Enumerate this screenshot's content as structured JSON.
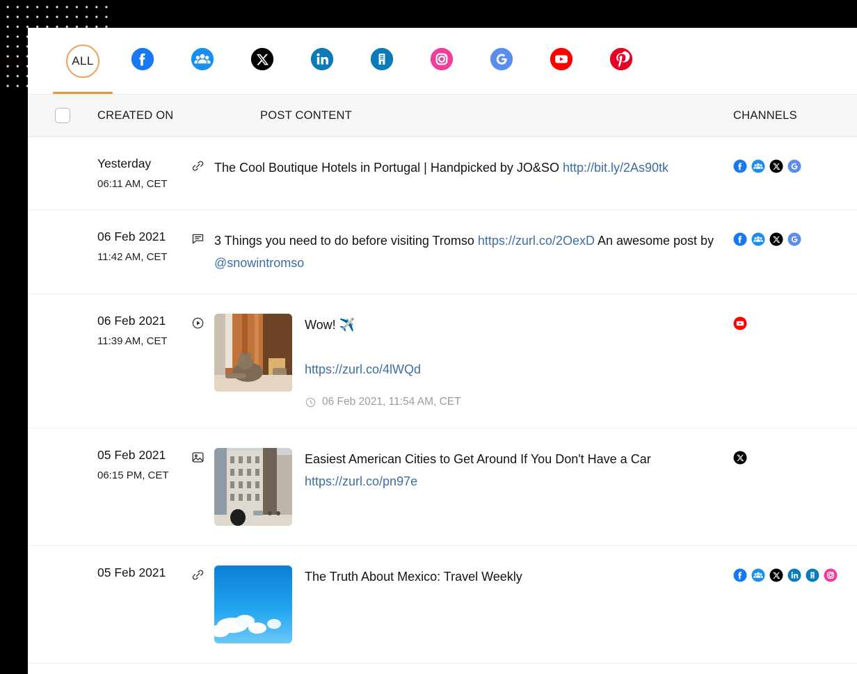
{
  "channel_tabs": [
    {
      "key": "all",
      "label": "ALL",
      "icon": "all-text",
      "active": true
    },
    {
      "key": "facebook",
      "label": "Facebook",
      "icon": "facebook-icon",
      "active": false
    },
    {
      "key": "fbgroup",
      "label": "Facebook Group",
      "icon": "facebook-group-icon",
      "active": false
    },
    {
      "key": "x",
      "label": "X",
      "icon": "x-twitter-icon",
      "active": false
    },
    {
      "key": "linkedin",
      "label": "LinkedIn",
      "icon": "linkedin-icon",
      "active": false
    },
    {
      "key": "lipage",
      "label": "LinkedIn Page",
      "icon": "linkedin-company-icon",
      "active": false
    },
    {
      "key": "instagram",
      "label": "Instagram",
      "icon": "instagram-icon",
      "active": false
    },
    {
      "key": "google",
      "label": "Google Business",
      "icon": "google-business-icon",
      "active": false
    },
    {
      "key": "youtube",
      "label": "YouTube",
      "icon": "youtube-icon",
      "active": false
    },
    {
      "key": "pinterest",
      "label": "Pinterest",
      "icon": "pinterest-icon",
      "active": false
    }
  ],
  "table": {
    "headers": {
      "select_all": "",
      "created_on": "CREATED ON",
      "post_content": "POST CONTENT",
      "channels": "CHANNELS"
    },
    "rows": [
      {
        "date": "Yesterday",
        "time": "06:11 AM, CET",
        "type_icon": "link-icon",
        "has_thumb": false,
        "segments": [
          {
            "text": "The Cool Boutique Hotels in Portugal | Handpicked by JO&SO ",
            "link": false
          },
          {
            "text": "http://bit.ly/2As90tk",
            "link": true
          }
        ],
        "scheduled": null,
        "channels": [
          "facebook-icon",
          "facebook-group-icon",
          "x-twitter-icon",
          "google-business-icon"
        ]
      },
      {
        "date": "06 Feb 2021",
        "time": "11:42 AM, CET",
        "type_icon": "text-post-icon",
        "has_thumb": false,
        "segments": [
          {
            "text": "3 Things you need to do before visiting Tromso ",
            "link": false
          },
          {
            "text": "https://zurl.co/2OexD",
            "link": true
          },
          {
            "text": " An awesome post by ",
            "link": false
          },
          {
            "text": "@snowintromso",
            "link": true
          }
        ],
        "scheduled": null,
        "channels": [
          "facebook-icon",
          "facebook-group-icon",
          "x-twitter-icon",
          "google-business-icon"
        ]
      },
      {
        "date": "06 Feb 2021",
        "time": "11:39 AM, CET",
        "type_icon": "video-icon",
        "has_thumb": true,
        "thumb_kind": "cat-photo",
        "segments": [
          {
            "text": "Wow! ✈️",
            "link": false
          },
          {
            "text": "\n",
            "link": false
          },
          {
            "text": "https://zurl.co/4lWQd",
            "link": true
          }
        ],
        "scheduled": "06 Feb 2021, 11:54 AM, CET",
        "channels": [
          "youtube-icon"
        ]
      },
      {
        "date": "05 Feb 2021",
        "time": "06:15 PM, CET",
        "type_icon": "image-icon",
        "has_thumb": true,
        "thumb_kind": "city-photo",
        "segments": [
          {
            "text": "Easiest American Cities to Get Around If You Don't Have a Car ",
            "link": false
          },
          {
            "text": "https://zurl.co/pn97e",
            "link": true
          }
        ],
        "scheduled": null,
        "channels": [
          "x-twitter-icon"
        ]
      },
      {
        "date": "05 Feb 2021",
        "time": "",
        "type_icon": "link-icon",
        "has_thumb": true,
        "thumb_kind": "sky-photo",
        "segments": [
          {
            "text": "The Truth About Mexico: Travel Weekly",
            "link": false
          }
        ],
        "scheduled": null,
        "channels": [
          "facebook-icon",
          "facebook-group-icon",
          "x-twitter-icon",
          "linkedin-icon",
          "linkedin-company-icon",
          "instagram-icon"
        ]
      }
    ]
  },
  "colors": {
    "accent": "#e8973f",
    "link": "#3a6ea5",
    "facebook": "#1877f2",
    "facebook_group": "#1b8ef2",
    "x": "#000000",
    "linkedin": "#0a7bb8",
    "linkedin_company": "#0a7bb8",
    "instagram": "#ef3d9a",
    "google": "#5b8def",
    "youtube": "#ff0000",
    "pinterest": "#e60023",
    "dot_pattern": "#f8cfc4",
    "header_bg": "#f6f6f7"
  }
}
